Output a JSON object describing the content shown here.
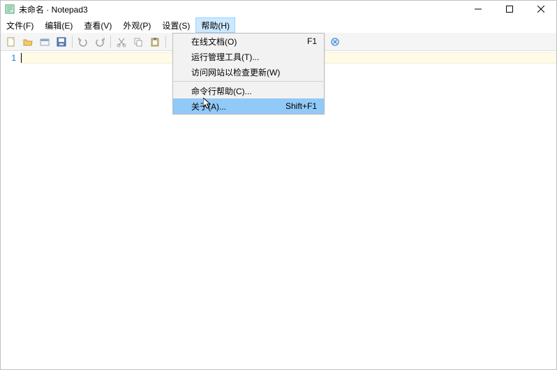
{
  "titlebar": {
    "title": "未命名 · Notepad3"
  },
  "menubar": {
    "items": [
      {
        "label": "文件(F)"
      },
      {
        "label": "编辑(E)"
      },
      {
        "label": "查看(V)"
      },
      {
        "label": "外观(P)"
      },
      {
        "label": "设置(S)"
      },
      {
        "label": "帮助(H)",
        "active": true
      }
    ]
  },
  "toolbar": {
    "icons": [
      "new-file-icon",
      "open-file-icon",
      "search-icon",
      "save-icon",
      "undo-icon",
      "redo-icon",
      "cut-icon",
      "copy-icon",
      "paste-icon",
      "find-icon",
      "replace-icon",
      "wordwrap-icon",
      "show-chars-icon",
      "zoom-in-icon",
      "zoom-out-icon",
      "toggle-icon",
      "pin-icon",
      "clear-icon"
    ]
  },
  "editor": {
    "line_numbers": [
      "1"
    ]
  },
  "help_menu": {
    "items": [
      {
        "label": "在线文档(O)",
        "shortcut": "F1"
      },
      {
        "label": "运行管理工具(T)..."
      },
      {
        "label": "访问网站以检查更新(W)"
      },
      {
        "sep": true
      },
      {
        "label": "命令行帮助(C)..."
      },
      {
        "label": "关于(A)...",
        "shortcut": "Shift+F1",
        "highlight": true
      }
    ]
  }
}
